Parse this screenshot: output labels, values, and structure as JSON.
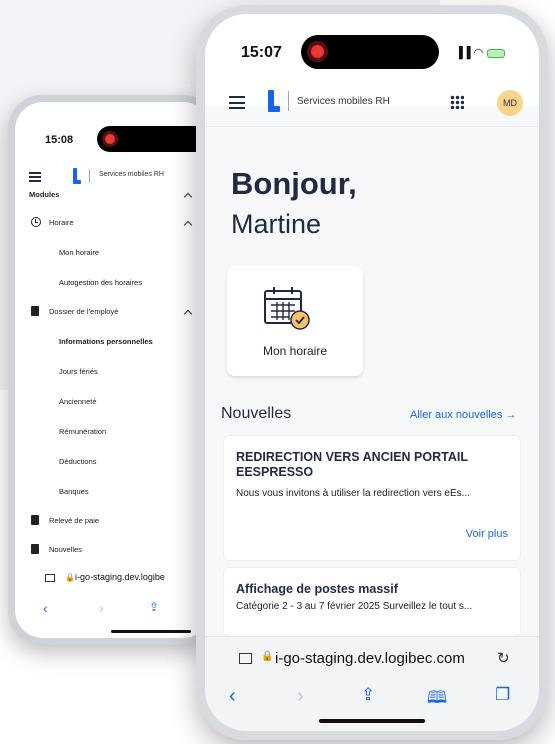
{
  "back_phone": {
    "time": "15:08",
    "app_title": "Services mobiles RH",
    "nav": {
      "modules": "Modules",
      "horaire": "Horaire",
      "mon_horaire": "Mon horaire",
      "autogestion": "Autogestion des horaires",
      "dossier": "Dossier de l'employé",
      "infos_perso": "Informations personnelles",
      "jours_feries": "Jours fériés",
      "anciennete": "Ancienneté",
      "remuneration": "Rémunération",
      "deductions": "Déductions",
      "banques": "Banques",
      "releve": "Relevé de paie",
      "nouvelles": "Nouvelles"
    },
    "url": "i-go-staging.dev.logibe"
  },
  "front_phone": {
    "time": "15:07",
    "app_title": "Services mobiles RH",
    "avatar_initials": "MD",
    "greeting": "Bonjour,",
    "user_name": "Martine",
    "tile_label": "Mon horaire",
    "news": {
      "heading": "Nouvelles",
      "link": "Aller aux nouvelles →",
      "items": [
        {
          "title": "REDIRECTION VERS ANCIEN PORTAIL EESPRESSO",
          "body": "Nous vous invitons à utiliser la redirection vers eEs...",
          "more": "Voir plus"
        },
        {
          "title": "Affichage de postes massif",
          "body": "Catégorie 2 - 3 au 7 février 2025 Surveillez le tout s..."
        }
      ]
    },
    "url": "i-go-staging.dev.logibec.com"
  },
  "colors": {
    "accent": "#1565e8",
    "heading": "#1f2a44",
    "avatar_bg": "#fbd38d"
  },
  "icons": [
    "menu-icon",
    "apps-grid-icon",
    "calendar-check-icon",
    "clock-icon",
    "document-icon",
    "lock-icon",
    "reload-icon",
    "back-icon",
    "forward-icon",
    "share-icon",
    "bookmarks-icon",
    "tabs-icon"
  ]
}
